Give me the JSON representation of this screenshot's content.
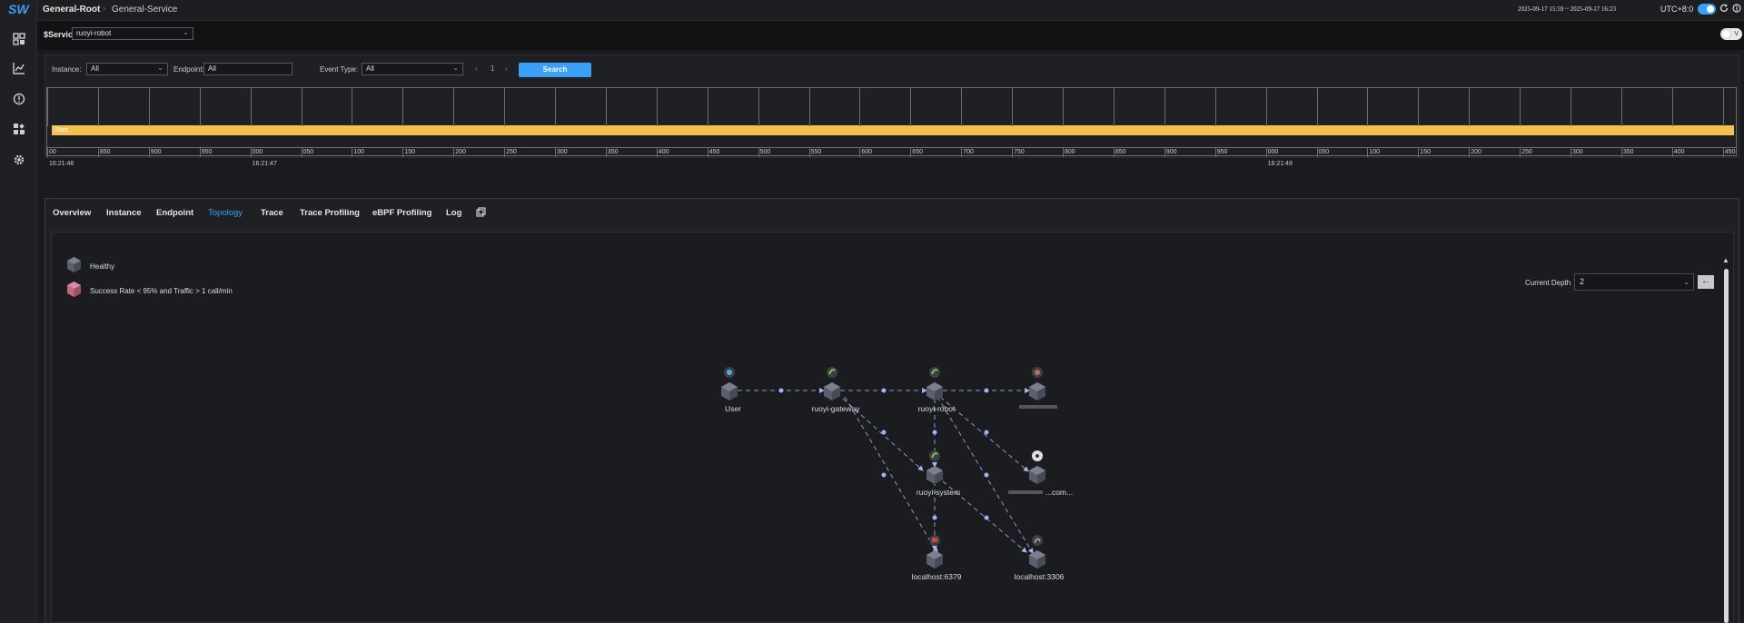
{
  "app": {
    "logo": "SW"
  },
  "breadcrumb": {
    "root": "General-Root",
    "separator": "›",
    "service": "General-Service"
  },
  "header": {
    "time_range": "2025-09-17 15:59 ~ 2025-09-17 16:23",
    "timezone": "UTC+8:0"
  },
  "sidebar": {
    "items": [
      {
        "name": "dashboard-icon"
      },
      {
        "name": "chart-icon"
      },
      {
        "name": "alert-icon"
      },
      {
        "name": "widgets-icon"
      },
      {
        "name": "settings-icon"
      }
    ]
  },
  "service_selector": {
    "label": "$Service",
    "value": "ruoyi-robot"
  },
  "view_toggle": {
    "label": "V"
  },
  "events": {
    "instance_label": "Instance:",
    "instance_value": "All",
    "endpoint_label": "Endpoint:",
    "endpoint_value": "All",
    "event_type_label": "Event Type:",
    "event_type_value": "All",
    "page_prev": "‹",
    "page_number": "1",
    "page_next": "›",
    "search_label": "Search",
    "timeline": {
      "bar_label": "Start",
      "ticks": [
        "00",
        "850",
        "900",
        "950",
        "000",
        "050",
        "100",
        "150",
        "200",
        "250",
        "300",
        "350",
        "400",
        "450",
        "500",
        "550",
        "600",
        "650",
        "700",
        "750",
        "800",
        "850",
        "900",
        "950",
        "000",
        "050",
        "100",
        "150",
        "200",
        "250",
        "300",
        "350",
        "400",
        "450"
      ],
      "times": [
        "16:21:46",
        "16:21:47",
        "16:21:48"
      ]
    }
  },
  "tabs": [
    {
      "label": "Overview",
      "active": false
    },
    {
      "label": "Instance",
      "active": false
    },
    {
      "label": "Endpoint",
      "active": false
    },
    {
      "label": "Topology",
      "active": true
    },
    {
      "label": "Trace",
      "active": false
    },
    {
      "label": "Trace Profiling",
      "active": false
    },
    {
      "label": "eBPF Profiling",
      "active": false
    },
    {
      "label": "Log",
      "active": false
    }
  ],
  "topology": {
    "legend": [
      {
        "label": "Healthy",
        "color": "#5b6070"
      },
      {
        "label": "Success Rate < 95% and Traffic > 1 call/min",
        "color": "#c06a86"
      }
    ],
    "depth_label": "Current Depth",
    "depth_value": "2",
    "nodes": [
      {
        "id": "user",
        "label": "User",
        "badge": "user-icon"
      },
      {
        "id": "gateway",
        "label": "ruoyi-gateway",
        "badge": "spring-icon"
      },
      {
        "id": "robot",
        "label": "ruoyi-robot",
        "badge": "spring-icon"
      },
      {
        "id": "blurred1",
        "label": "",
        "badge": "http-icon"
      },
      {
        "id": "system",
        "label": "ruoyi-system",
        "badge": "spring-icon"
      },
      {
        "id": "blurred2",
        "label": "...com...",
        "badge": "remote-icon"
      },
      {
        "id": "redis",
        "label": "localhost:6379",
        "badge": "redis-icon"
      },
      {
        "id": "mysql",
        "label": "localhost:3306",
        "badge": "mysql-icon"
      }
    ]
  }
}
